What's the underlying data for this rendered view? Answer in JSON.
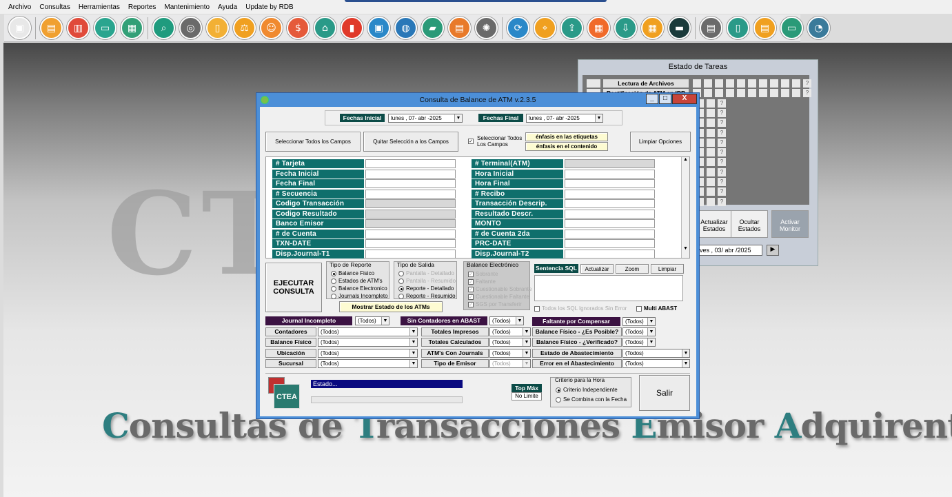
{
  "menu": [
    "Archivo",
    "Consultas",
    "Herramientas",
    "Reportes",
    "Mantenimiento",
    "Ayuda",
    "Update by RDB"
  ],
  "toolbar_icons": [
    {
      "name": "app-icon",
      "color": "#e8e8e8",
      "glyph": "▣"
    },
    {
      "name": "chart-icon",
      "color": "#f0a030",
      "glyph": "▤"
    },
    {
      "name": "disk-icon",
      "color": "#e04a3a",
      "glyph": "▥"
    },
    {
      "name": "monitor-icon",
      "color": "#2aa58f",
      "glyph": "▭"
    },
    {
      "name": "printer-icon",
      "color": "#33a077",
      "glyph": "▦"
    },
    {
      "name": "magnifier-icon",
      "color": "#1f9b7e",
      "glyph": "⌕"
    },
    {
      "name": "settings-icon",
      "color": "#6a6a6a",
      "glyph": "◎"
    },
    {
      "name": "document-icon",
      "color": "#f2b035",
      "glyph": "▯"
    },
    {
      "name": "scale-icon",
      "color": "#f0a020",
      "glyph": "⚖"
    },
    {
      "name": "user-icon",
      "color": "#f08a30",
      "glyph": "☺"
    },
    {
      "name": "money-icon",
      "color": "#e55a3a",
      "glyph": "$"
    },
    {
      "name": "network-icon",
      "color": "#2a9a88",
      "glyph": "⌂"
    },
    {
      "name": "book-icon",
      "color": "#e03a2a",
      "glyph": "▮"
    },
    {
      "name": "window-icon",
      "color": "#2a88c8",
      "glyph": "▣"
    },
    {
      "name": "globe-icon",
      "color": "#2a78b8",
      "glyph": "◍"
    },
    {
      "name": "folder-icon",
      "color": "#2a9a78",
      "glyph": "▰"
    },
    {
      "name": "terminal-icon",
      "color": "#e87a2a",
      "glyph": "▤"
    },
    {
      "name": "gear-icon",
      "color": "#6a6a6a",
      "glyph": "✺"
    },
    {
      "name": "sync-icon",
      "color": "#2a88c8",
      "glyph": "⟳"
    },
    {
      "name": "location-icon",
      "color": "#f0a020",
      "glyph": "⌖"
    },
    {
      "name": "upload-icon",
      "color": "#2a9a88",
      "glyph": "⇪"
    },
    {
      "name": "atm-icon",
      "color": "#f06a2a",
      "glyph": "▦"
    },
    {
      "name": "download-icon",
      "color": "#2a9a88",
      "glyph": "⇩"
    },
    {
      "name": "calculator-icon",
      "color": "#f0a020",
      "glyph": "▦"
    },
    {
      "name": "card-icon",
      "color": "#1a3a3a",
      "glyph": "▬"
    },
    {
      "name": "spreadsheet-icon",
      "color": "#6a6a6a",
      "glyph": "▤"
    },
    {
      "name": "phone-icon",
      "color": "#2a9a88",
      "glyph": "▯"
    },
    {
      "name": "notes-icon",
      "color": "#f0a020",
      "glyph": "▤"
    },
    {
      "name": "screen-icon",
      "color": "#2a9a78",
      "glyph": "▭"
    },
    {
      "name": "refresh-icon",
      "color": "#3a7a9a",
      "glyph": "◔"
    }
  ],
  "background": {
    "word": "CTEA",
    "tagline": [
      "C",
      "onsultas de ",
      "T",
      "ransacciones ",
      "E",
      "misor ",
      "A",
      "dquirente"
    ]
  },
  "estado": {
    "title": "Estado de Tareas",
    "rows": [
      "Lectura de Archivos",
      "Rectificación de ATM en IRR"
    ],
    "q": "?",
    "btn_actualizar": "Actualizar Estados",
    "btn_ocultar": "Ocultar Estados",
    "btn_activar": "Activar Monitor",
    "fecha": "ves  , 03/ abr /2025",
    "go": "▶"
  },
  "window": {
    "title": "Consulta de Balance de ATM v.2.3.5",
    "min": "_",
    "max": "□",
    "close": "X"
  },
  "dates": {
    "inicial_label": "Fechas Inicial",
    "inicial": "lunes  , 07- abr -2025",
    "final_label": "Fechas Final",
    "final": "lunes  , 07- abr -2025"
  },
  "buttons": {
    "select_all": "Seleccionar Todos los Campos",
    "quit_sel": "Quitar Selección a los Campos",
    "select_all_chk": "Seleccionar Todos Los Campos",
    "enf_etiq": "énfasis en las etiquetas",
    "enf_cont": "énfasis en el contenido",
    "limpiar": "Limpiar Opciones",
    "ejecutar": "EJECUTAR CONSULTA",
    "mostrar": "Mostrar Estado de los ATMs",
    "salir": "Salir",
    "actualizar": "Actualizar",
    "zoom": "Zoom",
    "limpiar_sql": "Limpiar"
  },
  "fields_left": [
    "# Tarjeta",
    "Fecha Inicial",
    "Fecha Final",
    "# Secuencia",
    "Codigo Transacción",
    "Codigo Resultado",
    "Banco Emisor",
    "# de Cuenta",
    "TXN-DATE",
    "Disp.Journal-T1"
  ],
  "fields_right": [
    "# Terminal(ATM)",
    "Hora Inicial",
    "Hora Final",
    "# Recibo",
    "Transacción Descrip.",
    "Resultado Descr.",
    "MONTO",
    "# de Cuenta 2da",
    "PRC-DATE",
    "Disp.Journal-T2"
  ],
  "tipo_reporte": {
    "title": "Tipo de Reporte",
    "options": [
      "Balance Fisico",
      "Estados de ATM's",
      "Balance Electronico",
      "Journals Incompleto"
    ]
  },
  "tipo_salida": {
    "title": "Tipo de Salida",
    "options": [
      "Pantalla - Detallado",
      "Pantalla - Resumido",
      "Reporte - Detallado",
      "Reporte - Resumido"
    ]
  },
  "balance_elec": {
    "title": "Balance Electrónico",
    "options": [
      "Sobrante",
      "Faltante",
      "Cuestionable Sobrante",
      "Cuestionable Faltante",
      "SGS por Transferir"
    ]
  },
  "sql": {
    "title": "Sentencia SQL",
    "ignorar": "Todos los SQL Ignorados Sin Error",
    "multi": "Multi ABAST"
  },
  "filters_top": {
    "journal": "Journal Incompleto",
    "journal_val": "(Todos)",
    "sin_cont": "Sin Contadores en ABAST",
    "sin_cont_val": "(Todos)",
    "faltante": "Faltante por Compensar",
    "faltante_val": "(Todos)"
  },
  "filters": [
    {
      "a": "Contadores",
      "av": "(Todos)",
      "b": "Totales Impresos",
      "bv": "(Todos)",
      "c": "Balance Físico - ¿Es Posible?",
      "cv": "(Todos)"
    },
    {
      "a": "Balance Físico",
      "av": "(Todos)",
      "b": "Totales Calculados",
      "bv": "(Todos)",
      "c": "Balance Físico - ¿Verificado?",
      "cv": "(Todos)"
    },
    {
      "a": "Ubicación",
      "av": "(Todos)",
      "b": "ATM's Con Journals",
      "bv": "(Todos)",
      "c": "Estado de Abastecimiento",
      "cv": "(Todos)"
    },
    {
      "a": "Sucursal",
      "av": "(Todos)",
      "b": "Tipo de Emisor",
      "bv": "(Todos)",
      "c": "Error en el Abastecimiento",
      "cv": "(Todos)"
    }
  ],
  "status": {
    "estado": "Estado...",
    "top_label": "Top Máx",
    "top_val": "No Limite",
    "logo": "CTEA"
  },
  "criterio": {
    "title": "Criterio para la  Hora",
    "o1": "Criterio Independiente",
    "o2": "Se Combina con la Fecha"
  },
  "colors": {
    "accent": "#0f6f6c",
    "purple": "#3b1242",
    "titlebar": "#4c8fd8"
  }
}
